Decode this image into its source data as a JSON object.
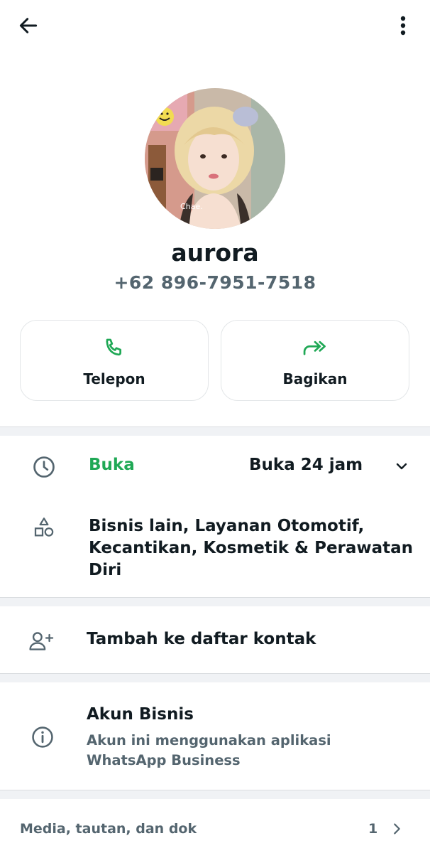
{
  "header": {
    "back_icon": "arrow-left-icon",
    "menu_icon": "more-vertical-icon"
  },
  "profile": {
    "name": "aurora",
    "phone": "+62 896-7951-7518"
  },
  "actions": {
    "call_label": "Telepon",
    "call_icon": "phone-icon",
    "share_label": "Bagikan",
    "share_icon": "share-forward-icon"
  },
  "business_hours": {
    "status": "Buka",
    "value": "Buka 24 jam",
    "icon": "clock-icon",
    "expand_icon": "chevron-down-icon"
  },
  "category": {
    "text": "Bisnis lain, Layanan Otomotif, Kecantikan, Kosmetik & Perawatan Diri",
    "icon": "shapes-icon"
  },
  "add_contact": {
    "label": "Tambah ke daftar kontak",
    "icon": "add-user-icon"
  },
  "business_account": {
    "title": "Akun Bisnis",
    "description": "Akun ini menggunakan aplikasi WhatsApp Business",
    "icon": "info-icon"
  },
  "media": {
    "label": "Media, tautan, dan dok",
    "count": "1",
    "icon": "chevron-right-icon"
  },
  "colors": {
    "accent_green": "#1fa855",
    "text_primary": "#111b21",
    "text_secondary": "#54656f",
    "separator": "#f0f2f5"
  }
}
